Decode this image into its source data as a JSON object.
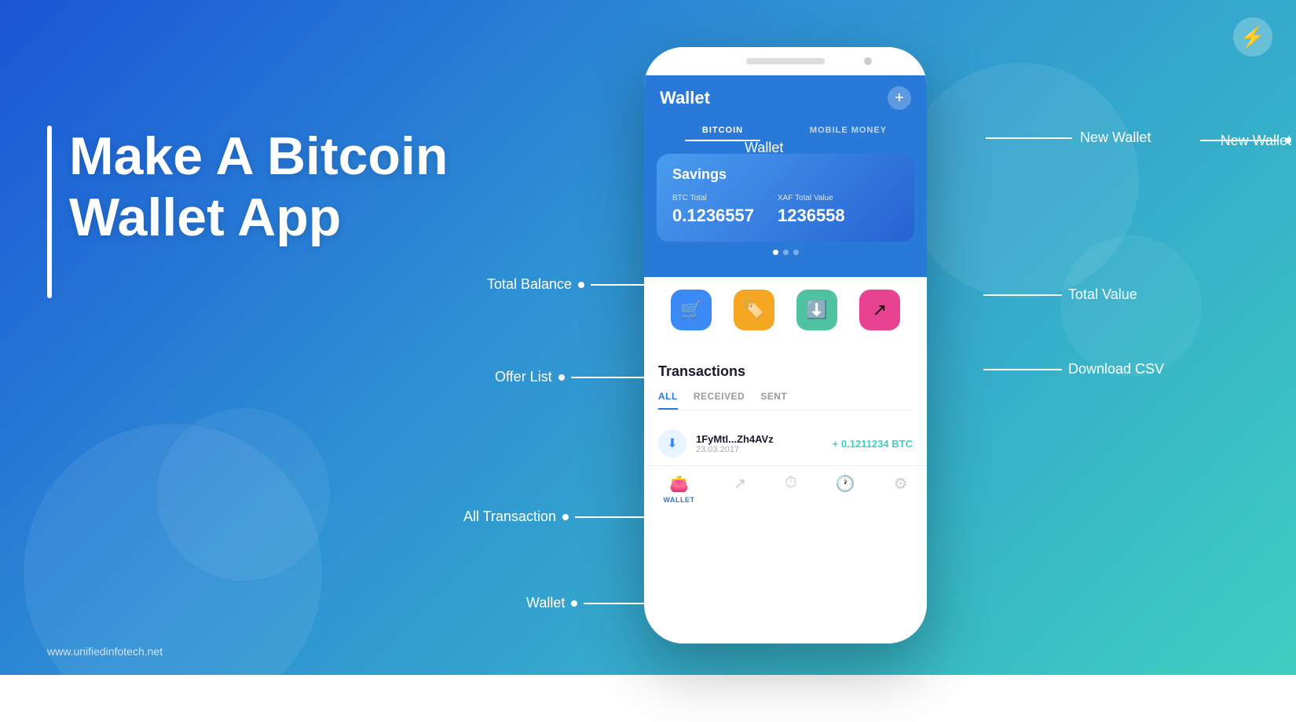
{
  "background": {
    "gradient_start": "#1a56d6",
    "gradient_end": "#3ecfc0"
  },
  "logo": {
    "symbol": "⚡"
  },
  "left_section": {
    "title_line1": "Make A Bitcoin",
    "title_line2": "Wallet App",
    "website": "www.unifiedinfotech.net"
  },
  "phone": {
    "header": {
      "title": "Wallet",
      "plus_label": "+",
      "tabs": [
        {
          "label": "BITCOIN",
          "active": true
        },
        {
          "label": "MOBILE MONEY",
          "active": false
        }
      ]
    },
    "savings_card": {
      "title": "Savings",
      "btc_label": "BTC Total",
      "btc_value": "0.1236557",
      "xaf_label": "XAF Total Value",
      "xaf_value": "1236558"
    },
    "action_buttons": [
      {
        "icon": "🛒",
        "color": "blue",
        "label": "offer-list"
      },
      {
        "icon": "🏷",
        "color": "yellow",
        "label": "tag"
      },
      {
        "icon": "⬇",
        "color": "green",
        "label": "download"
      },
      {
        "icon": "↗",
        "color": "pink",
        "label": "share"
      }
    ],
    "transactions": {
      "title": "Transactions",
      "tabs": [
        {
          "label": "ALL",
          "active": true
        },
        {
          "label": "RECEIVED",
          "active": false
        },
        {
          "label": "SENT",
          "active": false
        }
      ],
      "items": [
        {
          "address": "1FyMtI...Zh4AVz",
          "date": "23.03.2017",
          "amount": "+ 0.1211234 BTC"
        }
      ]
    },
    "bottom_nav": [
      {
        "icon": "👛",
        "label": "WALLET",
        "active": true
      },
      {
        "icon": "↗",
        "label": "",
        "active": false
      },
      {
        "icon": "⏰",
        "label": "",
        "active": false
      },
      {
        "icon": "🕐",
        "label": "",
        "active": false
      },
      {
        "icon": "⚙",
        "label": "",
        "active": false
      }
    ]
  },
  "annotations": {
    "wallet": "Wallet",
    "new_wallet": "New Wallet",
    "total_balance": "Total Balance",
    "total_value": "Total Value",
    "offer_list": "Offer List",
    "download_csv": "Download CSV",
    "all_transaction": "All Transaction",
    "wallet_bottom": "Wallet"
  }
}
